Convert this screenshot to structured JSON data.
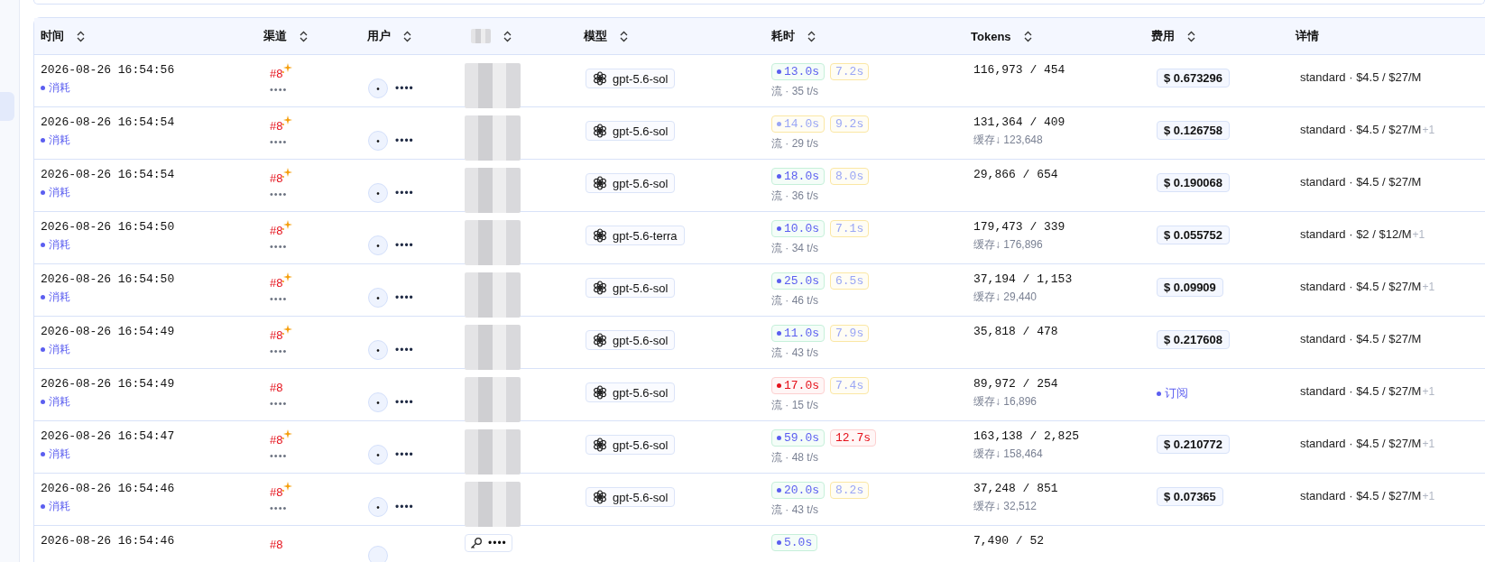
{
  "table": {
    "columns": [
      {
        "label": "时间",
        "sortable": true
      },
      {
        "label": "渠道",
        "sortable": true
      },
      {
        "label": "用户",
        "sortable": true
      },
      {
        "sortable": true
      },
      {
        "label": "模型",
        "sortable": true
      },
      {
        "label": "耗时",
        "sortable": true
      },
      {
        "label": "Tokens",
        "sortable": true
      },
      {
        "label": "费用",
        "sortable": true
      },
      {
        "label": "详情",
        "sortable": false
      }
    ],
    "rows": [
      {
        "time": "2026-08-26 16:54:56",
        "type": "消耗",
        "channel": "#8",
        "sparkle": true,
        "channel_sub": "••••",
        "avatar": "•",
        "user": "••••",
        "token": {
          "redacted": true
        },
        "model": "gpt-5.6-sol",
        "durations": [
          {
            "text": "13.0s",
            "kind": "ok"
          },
          {
            "text": "7.2s",
            "kind": "warn"
          }
        ],
        "speed": "流 · 35 t/s",
        "tokens": "116,973 / 454",
        "cost": {
          "kind": "amount",
          "text": "$ 0.673296"
        },
        "detail": "standard · $4.5 / $27/M"
      },
      {
        "time": "2026-08-26 16:54:54",
        "type": "消耗",
        "channel": "#8",
        "sparkle": true,
        "channel_sub": "••••",
        "avatar": "•",
        "user": "••••",
        "token": {
          "redacted": true
        },
        "model": "gpt-5.6-sol",
        "durations": [
          {
            "text": "14.0s",
            "kind": "warn"
          },
          {
            "text": "9.2s",
            "kind": "warn"
          }
        ],
        "speed": "流 · 29 t/s",
        "tokens": "131,364 / 409",
        "cache": "缓存↓ 123,648",
        "cost": {
          "kind": "amount",
          "text": "$ 0.126758"
        },
        "detail": "standard · $4.5 / $27/M",
        "extra": "+1"
      },
      {
        "time": "2026-08-26 16:54:54",
        "type": "消耗",
        "channel": "#8",
        "sparkle": true,
        "channel_sub": "••••",
        "avatar": "•",
        "user": "••••",
        "token": {
          "redacted": true
        },
        "model": "gpt-5.6-sol",
        "durations": [
          {
            "text": "18.0s",
            "kind": "ok"
          },
          {
            "text": "8.0s",
            "kind": "warn"
          }
        ],
        "speed": "流 · 36 t/s",
        "tokens": "29,866 / 654",
        "cost": {
          "kind": "amount",
          "text": "$ 0.190068"
        },
        "detail": "standard · $4.5 / $27/M"
      },
      {
        "time": "2026-08-26 16:54:50",
        "type": "消耗",
        "channel": "#8",
        "sparkle": true,
        "channel_sub": "••••",
        "avatar": "•",
        "user": "••••",
        "token": {
          "redacted": true
        },
        "model": "gpt-5.6-terra",
        "durations": [
          {
            "text": "10.0s",
            "kind": "ok"
          },
          {
            "text": "7.1s",
            "kind": "warn"
          }
        ],
        "speed": "流 · 34 t/s",
        "tokens": "179,473 / 339",
        "cache": "缓存↓ 176,896",
        "cost": {
          "kind": "amount",
          "text": "$ 0.055752"
        },
        "detail": "standard · $2 / $12/M",
        "extra": "+1"
      },
      {
        "time": "2026-08-26 16:54:50",
        "type": "消耗",
        "channel": "#8",
        "sparkle": true,
        "channel_sub": "••••",
        "avatar": "•",
        "user": "••••",
        "token": {
          "redacted": true
        },
        "model": "gpt-5.6-sol",
        "durations": [
          {
            "text": "25.0s",
            "kind": "ok"
          },
          {
            "text": "6.5s",
            "kind": "warn"
          }
        ],
        "speed": "流 · 46 t/s",
        "tokens": "37,194 / 1,153",
        "cache": "缓存↓ 29,440",
        "cost": {
          "kind": "amount",
          "text": "$ 0.09909"
        },
        "detail": "standard · $4.5 / $27/M",
        "extra": "+1"
      },
      {
        "time": "2026-08-26 16:54:49",
        "type": "消耗",
        "channel": "#8",
        "sparkle": true,
        "channel_sub": "••••",
        "avatar": "•",
        "user": "••••",
        "token": {
          "redacted": true
        },
        "model": "gpt-5.6-sol",
        "durations": [
          {
            "text": "11.0s",
            "kind": "ok"
          },
          {
            "text": "7.9s",
            "kind": "warn"
          }
        ],
        "speed": "流 · 43 t/s",
        "tokens": "35,818 / 478",
        "cost": {
          "kind": "amount",
          "text": "$ 0.217608"
        },
        "detail": "standard · $4.5 / $27/M"
      },
      {
        "time": "2026-08-26 16:54:49",
        "type": "消耗",
        "channel": "#8",
        "sparkle": false,
        "channel_sub": "••••",
        "avatar": "•",
        "user": "••••",
        "token": {
          "redacted": true
        },
        "model": "gpt-5.6-sol",
        "durations": [
          {
            "text": "17.0s",
            "kind": "bad"
          },
          {
            "text": "7.4s",
            "kind": "warn"
          }
        ],
        "speed": "流 · 15 t/s",
        "tokens": "89,972 / 254",
        "cache": "缓存↓ 16,896",
        "cost": {
          "kind": "subscription",
          "text": "订阅"
        },
        "detail": "standard · $4.5 / $27/M",
        "extra": "+1"
      },
      {
        "time": "2026-08-26 16:54:47",
        "type": "消耗",
        "channel": "#8",
        "sparkle": true,
        "channel_sub": "••••",
        "avatar": "•",
        "user": "••••",
        "token": {
          "redacted": true
        },
        "model": "gpt-5.6-sol",
        "durations": [
          {
            "text": "59.0s",
            "kind": "ok"
          },
          {
            "text": "12.7s",
            "kind": "bad"
          }
        ],
        "speed": "流 · 48 t/s",
        "tokens": "163,138 / 2,825",
        "cache": "缓存↓ 158,464",
        "cost": {
          "kind": "amount",
          "text": "$ 0.210772"
        },
        "detail": "standard · $4.5 / $27/M",
        "extra": "+1"
      },
      {
        "time": "2026-08-26 16:54:46",
        "type": "消耗",
        "channel": "#8",
        "sparkle": true,
        "channel_sub": "••••",
        "avatar": "•",
        "user": "••••",
        "token": {
          "redacted": true
        },
        "model": "gpt-5.6-sol",
        "durations": [
          {
            "text": "20.0s",
            "kind": "ok"
          },
          {
            "text": "8.2s",
            "kind": "warn"
          }
        ],
        "speed": "流 · 43 t/s",
        "tokens": "37,248 / 851",
        "cache": "缓存↓ 32,512",
        "cost": {
          "kind": "amount",
          "text": "$ 0.07365"
        },
        "detail": "standard · $4.5 / $27/M",
        "extra": "+1"
      },
      {
        "time": "2026-08-26 16:54:46",
        "channel": "#8",
        "sparkle": false,
        "token": {
          "redacted": false,
          "label": "••••"
        },
        "durations": [
          {
            "text": "5.0s",
            "kind": "ok"
          }
        ],
        "tokens": "7,490 / 52"
      }
    ]
  }
}
